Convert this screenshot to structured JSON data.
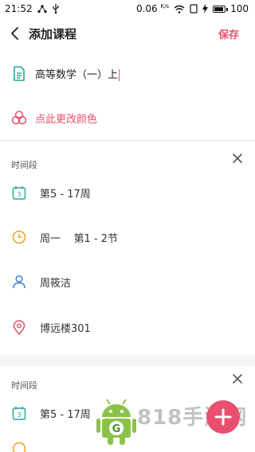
{
  "status_bar": {
    "time": "21:52",
    "net_speed": "0.06",
    "net_unit": "K/s",
    "battery": "100",
    "battery_level": 1.0
  },
  "toolbar": {
    "title": "添加课程",
    "save_label": "保存"
  },
  "course": {
    "name": "高等数学（一）上"
  },
  "color_action": {
    "label": "点此更改颜色"
  },
  "time_slots": [
    {
      "section_label": "时间段",
      "weeks": "第5 - 17周",
      "day_period": "周一    第1 - 2节",
      "teacher": "周筱洁",
      "location": "博远楼301"
    },
    {
      "section_label": "时间段",
      "weeks": "第5 - 17周"
    }
  ],
  "watermark": {
    "text": "818手游网"
  },
  "colors": {
    "accent": "#e8506e",
    "teal": "#27a69a",
    "orange": "#f0a020",
    "blue": "#3c7bd6",
    "red": "#e0505a",
    "android_green": "#8bc34a"
  },
  "icons": [
    "back-arrow-icon",
    "document-icon",
    "palette-icon",
    "calendar-icon",
    "clock-icon",
    "person-icon",
    "location-pin-icon",
    "close-icon"
  ]
}
